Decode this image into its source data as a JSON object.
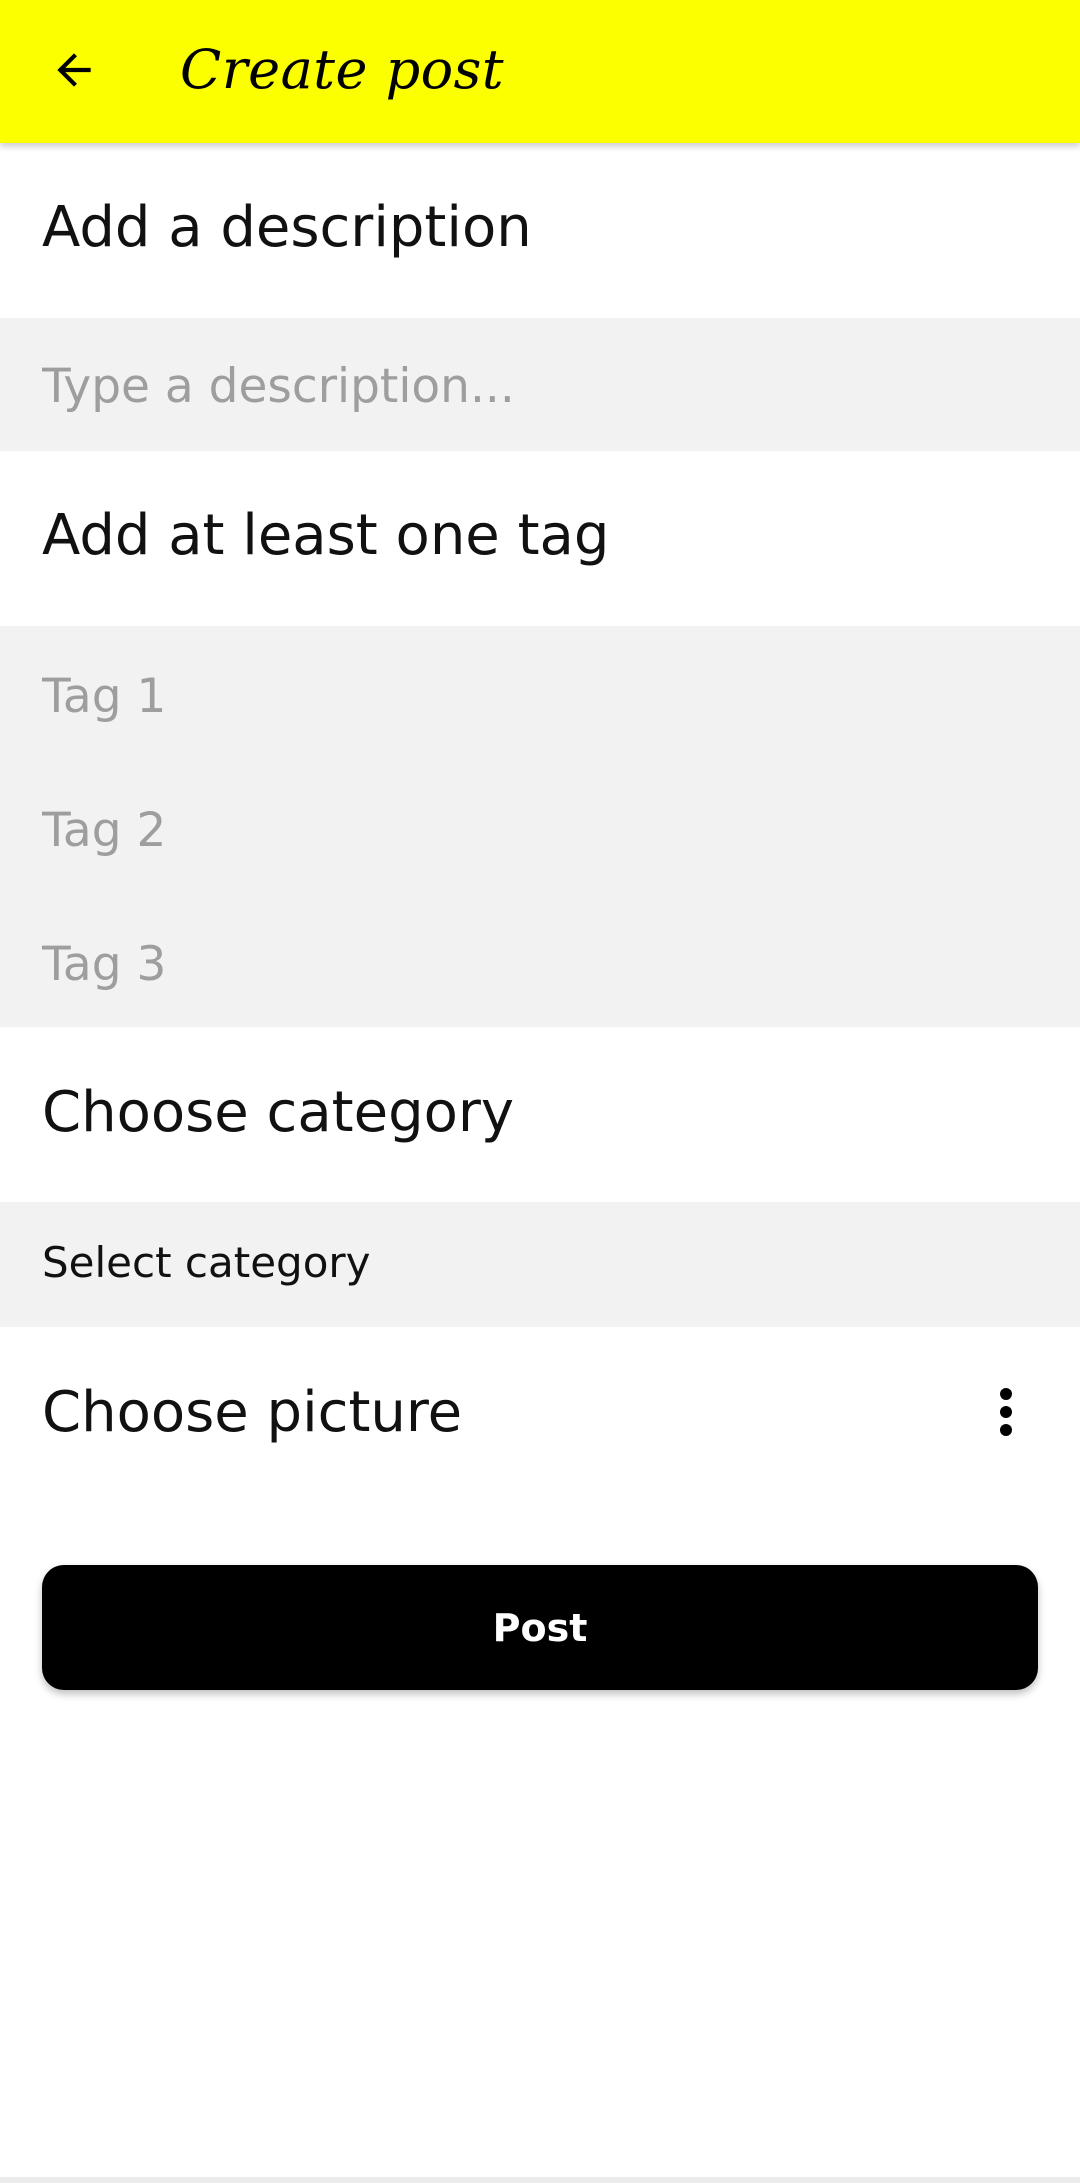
{
  "appbar": {
    "title": "Create post",
    "back_icon": "arrow-left-icon",
    "background_color": "#fbff00"
  },
  "description_section": {
    "label": "Add a description",
    "placeholder": "Type a description...",
    "value": ""
  },
  "tags_section": {
    "label": "Add at least one tag",
    "tags": [
      {
        "placeholder": "Tag 1",
        "value": ""
      },
      {
        "placeholder": "Tag 2",
        "value": ""
      },
      {
        "placeholder": "Tag 3",
        "value": ""
      }
    ]
  },
  "category_section": {
    "label": "Choose category",
    "selected": "Select category"
  },
  "picture_section": {
    "label": "Choose picture",
    "menu_icon": "more-vertical-icon"
  },
  "post_button": {
    "label": "Post"
  },
  "colors": {
    "accent": "#fbff00",
    "field_background": "#f2f2f2",
    "button_background": "#000000"
  }
}
